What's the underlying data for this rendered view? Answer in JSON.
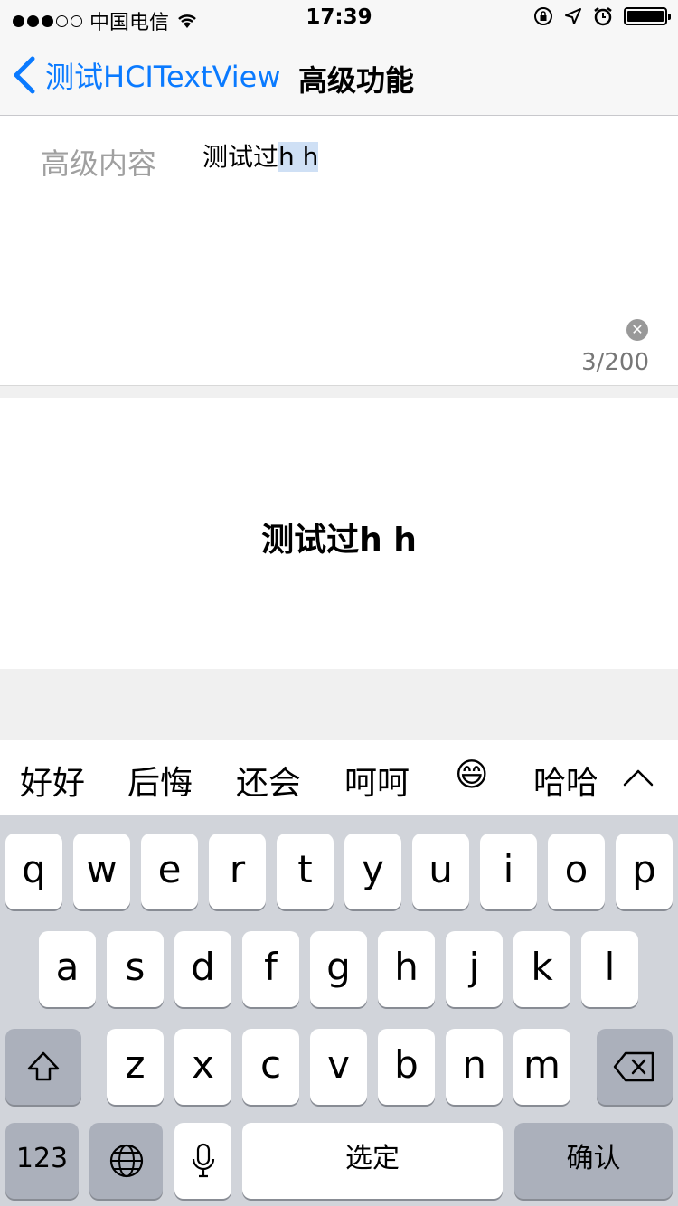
{
  "status_bar": {
    "carrier": "中国电信",
    "time": "17:39"
  },
  "nav": {
    "back_label": "测试HCITextView",
    "title": "高级功能"
  },
  "editor": {
    "label": "高级内容",
    "text_plain": "测试过",
    "text_marked": "h h",
    "counter": "3/200"
  },
  "preview": {
    "text": "测试过h h"
  },
  "candidates": [
    "好好",
    "后悔",
    "还会",
    "呵呵",
    "😄",
    "哈哈"
  ],
  "keyboard": {
    "row1": [
      "q",
      "w",
      "e",
      "r",
      "t",
      "y",
      "u",
      "i",
      "o",
      "p"
    ],
    "row2": [
      "a",
      "s",
      "d",
      "f",
      "g",
      "h",
      "j",
      "k",
      "l"
    ],
    "row3": [
      "z",
      "x",
      "c",
      "v",
      "b",
      "n",
      "m"
    ],
    "numbers_label": "123",
    "space_label": "选定",
    "return_label": "确认"
  },
  "colors": {
    "accent": "#0a7aff",
    "selection": "#cfe0f5"
  }
}
